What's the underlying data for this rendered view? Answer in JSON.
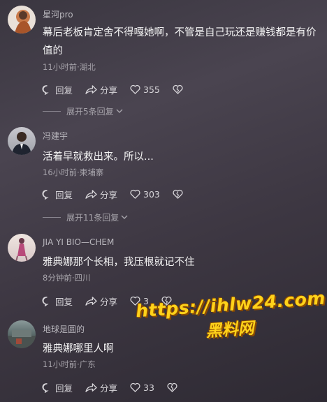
{
  "comments": [
    {
      "username": "星河pro",
      "content": "幕后老板肯定舍不得嘎她啊，不管是自己玩还是赚钱都是有价值的",
      "meta": "11小时前·湖北",
      "reply_label": "回复",
      "share_label": "分享",
      "likes": "355",
      "expand_label": "展开5条回复"
    },
    {
      "username": "冯建宇",
      "content": "活着早就救出来。所以...",
      "meta": "16小时前·柬埔寨",
      "reply_label": "回复",
      "share_label": "分享",
      "likes": "303",
      "expand_label": "展开11条回复"
    },
    {
      "username": "JIA YI BIO—CHEM",
      "content": "雅典娜那个长相，我压根就记不住",
      "meta": "8分钟前·四川",
      "reply_label": "回复",
      "share_label": "分享",
      "likes": "3"
    },
    {
      "username": "地球是圆的",
      "content": "雅典娜哪里人啊",
      "meta": "11小时前·广东",
      "reply_label": "回复",
      "share_label": "分享",
      "likes": "33"
    }
  ],
  "watermark": {
    "url": "https://ihlw24.com",
    "brand": "黑料网"
  },
  "colors": {
    "background": "#433d48",
    "watermark": "#ffd21a"
  }
}
